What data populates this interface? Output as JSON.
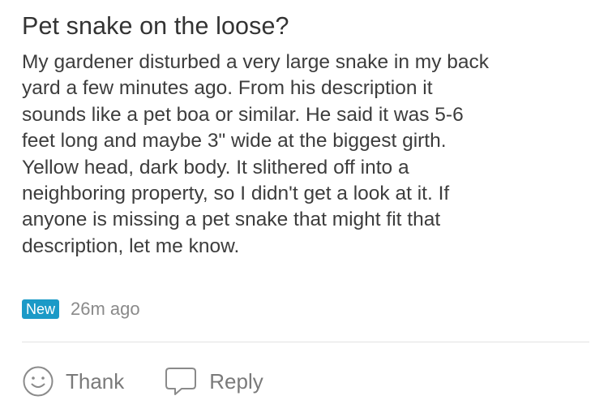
{
  "post": {
    "title": "Pet snake on the loose?",
    "body_lines": [
      "My gardener disturbed a very large snake in my back",
      "yard a few minutes ago.  From his description it",
      "sounds like a pet boa or similar.  He said it was 5-6",
      "feet long and maybe 3\" wide at the biggest girth.",
      "Yellow head, dark body.  It slithered off into a",
      "neighboring property, so I didn't get a look at it.  If",
      "anyone is missing a pet snake that might fit that",
      "description, let me know."
    ]
  },
  "meta": {
    "badge": "New",
    "timestamp": "26m ago",
    "badge_color": "#1b9ac7"
  },
  "actions": {
    "thank_label": "Thank",
    "thank_icon": "smiley-icon",
    "reply_label": "Reply",
    "reply_icon": "speech-bubble-icon"
  }
}
